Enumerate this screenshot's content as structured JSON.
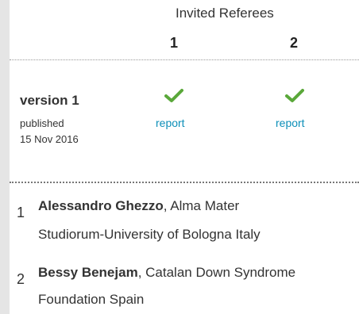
{
  "header": {
    "title": "Invited Referees",
    "columns": [
      "1",
      "2"
    ]
  },
  "version": {
    "label": "version 1",
    "published_label": "published",
    "date": "15 Nov 2016",
    "reports": [
      {
        "status_icon": "check-icon",
        "link": "report"
      },
      {
        "status_icon": "check-icon",
        "link": "report"
      }
    ]
  },
  "referees": [
    {
      "num": "1",
      "name": "Alessandro Ghezzo",
      "affil_line1": ", Alma Mater",
      "affil_line2": "Studiorum-University of Bologna Italy"
    },
    {
      "num": "2",
      "name": "Bessy Benejam",
      "affil_line1": ", Catalan Down Syndrome",
      "affil_line2": "Foundation Spain"
    }
  ],
  "colors": {
    "check": "#5aa83a",
    "link": "#0d8fb8",
    "stripe": "#e5e5e5"
  }
}
